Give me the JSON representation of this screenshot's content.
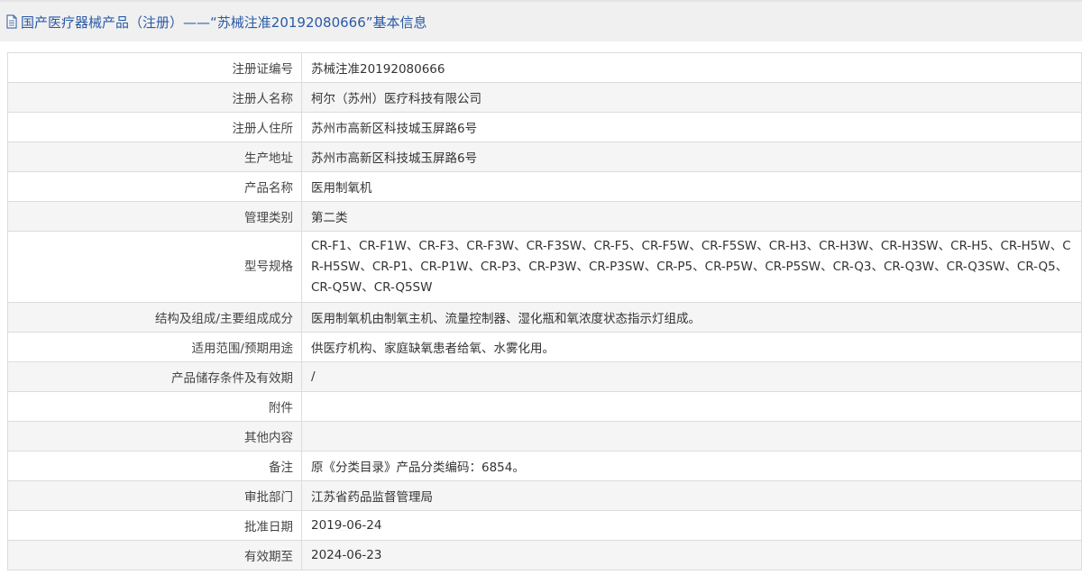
{
  "header": {
    "title": "国产医疗器械产品（注册）——“苏械注准20192080666”基本信息",
    "icon": "document-icon"
  },
  "rows": [
    {
      "label": "注册证编号",
      "value": "苏械注准20192080666"
    },
    {
      "label": "注册人名称",
      "value": "柯尔（苏州）医疗科技有限公司"
    },
    {
      "label": "注册人住所",
      "value": "苏州市高新区科技城玉屏路6号"
    },
    {
      "label": "生产地址",
      "value": "苏州市高新区科技城玉屏路6号"
    },
    {
      "label": "产品名称",
      "value": "医用制氧机"
    },
    {
      "label": "管理类别",
      "value": "第二类"
    },
    {
      "label": "型号规格",
      "value": "CR-F1、CR-F1W、CR-F3、CR-F3W、CR-F3SW、CR-F5、CR-F5W、CR-F5SW、CR-H3、CR-H3W、CR-H3SW、CR-H5、CR-H5W、CR-H5SW、CR-P1、CR-P1W、CR-P3、CR-P3W、CR-P3SW、CR-P5、CR-P5W、CR-P5SW、CR-Q3、CR-Q3W、CR-Q3SW、CR-Q5、CR-Q5W、CR-Q5SW"
    },
    {
      "label": "结构及组成/主要组成成分",
      "value": "医用制氧机由制氧主机、流量控制器、湿化瓶和氧浓度状态指示灯组成。"
    },
    {
      "label": "适用范围/预期用途",
      "value": "供医疗机构、家庭缺氧患者给氧、水雾化用。"
    },
    {
      "label": "产品储存条件及有效期",
      "value": "/"
    },
    {
      "label": "附件",
      "value": ""
    },
    {
      "label": "其他内容",
      "value": ""
    },
    {
      "label": "备注",
      "value": "原《分类目录》产品分类编码：6854。"
    },
    {
      "label": "审批部门",
      "value": "江苏省药品监督管理局"
    },
    {
      "label": "批准日期",
      "value": "2019-06-24"
    },
    {
      "label": "有效期至",
      "value": "2024-06-23"
    }
  ],
  "colors": {
    "title": "#2a5aa6",
    "header_bg": "#f0f0f0",
    "row_shade": "#f5f5f5",
    "border": "#dcdcdc"
  }
}
